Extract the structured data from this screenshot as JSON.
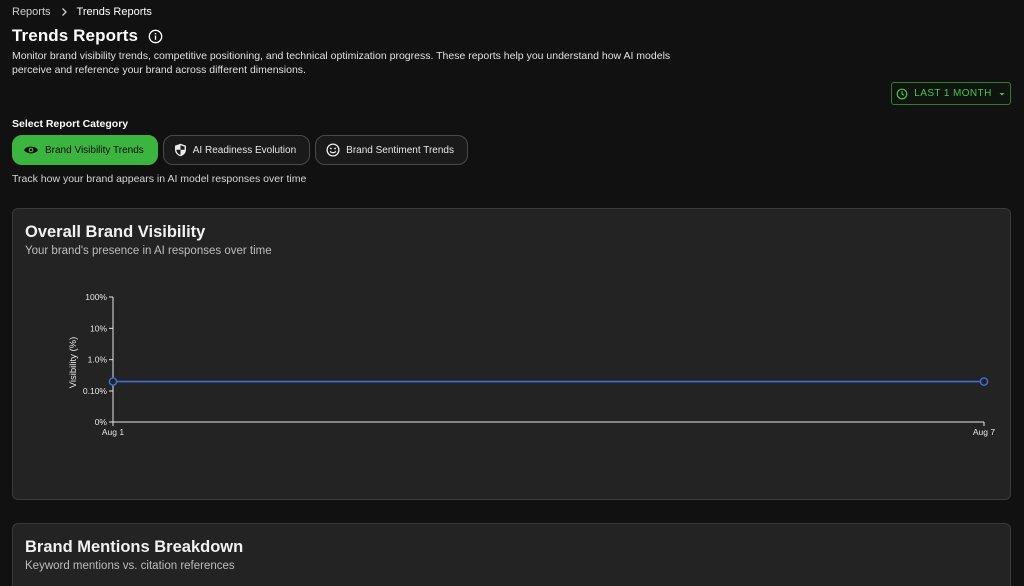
{
  "breadcrumb": {
    "parent": "Reports",
    "current": "Trends Reports"
  },
  "header": {
    "title": "Trends Reports",
    "description": "Monitor brand visibility trends, competitive positioning, and technical optimization progress. These reports help you understand how AI models perceive and reference your brand across different dimensions."
  },
  "range": {
    "label": "LAST 1 MONTH"
  },
  "categories": {
    "label": "Select Report Category",
    "items": [
      {
        "label": "Brand Visibility Trends",
        "icon": "eye-icon",
        "active": true
      },
      {
        "label": "AI Readiness Evolution",
        "icon": "shield-icon",
        "active": false
      },
      {
        "label": "Brand Sentiment Trends",
        "icon": "smiley-icon",
        "active": false
      }
    ],
    "description": "Track how your brand appears in AI model responses over time"
  },
  "cards": {
    "visibility": {
      "title": "Overall Brand Visibility",
      "subtitle": "Your brand's presence in AI responses over time"
    },
    "mentions": {
      "title": "Brand Mentions Breakdown",
      "subtitle": "Keyword mentions vs. citation references"
    }
  },
  "colors": {
    "accent": "#3bb53f",
    "series": "#3f6fd8"
  },
  "chart_data": {
    "type": "line",
    "ylabel": "Visibility (%)",
    "yscale": "log",
    "ytick_labels": [
      "0%",
      "0.10%",
      "1.0%",
      "10%",
      "100%"
    ],
    "x": [
      "Aug 1",
      "Aug 7"
    ],
    "series": [
      {
        "values": [
          0.2,
          0.2
        ]
      }
    ],
    "grid": false
  }
}
